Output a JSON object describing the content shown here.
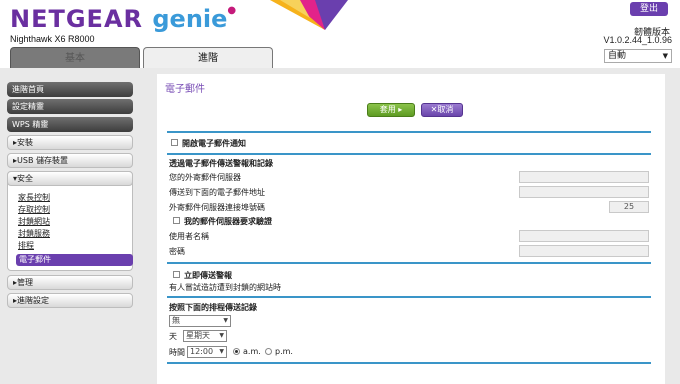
{
  "header": {
    "brand": "NETGEAR",
    "product": "genie",
    "model": "Nighthawk X6 R8000",
    "logout_label": "登出",
    "firmware_label": "韌體版本",
    "firmware_version": "V1.0.2.44_1.0.96",
    "language": "自動"
  },
  "tabs": [
    {
      "label": "基本",
      "selected": false
    },
    {
      "label": "進階",
      "selected": true
    }
  ],
  "sidebar": {
    "home": "進階首頁",
    "setup_wizard": "設定精靈",
    "wps_wizard": "WPS 精靈",
    "setup": "▸安裝",
    "usb_storage": "▸USB 儲存裝置",
    "security": "▾安全",
    "security_items": [
      "家長控制",
      "存取控制",
      "封鎖網站",
      "封鎖服務",
      "排程"
    ],
    "email_active": "電子郵件",
    "admin": "▸管理",
    "advanced_setup": "▸進階設定"
  },
  "main": {
    "title": "電子郵件",
    "apply_label": "套用 ▸",
    "cancel_label": "✕取消",
    "enable_notify": "開啟電子郵件通知",
    "send_logs_heading": "透過電子郵件傳送警報和記錄",
    "smtp_server": "您的外寄郵件伺服器",
    "send_to": "傳送到下面的電子郵件地址",
    "smtp_port_label": "外寄郵件伺服器連接埠號碼",
    "smtp_port_value": "25",
    "auth_required": "我的郵件伺服器要求驗證",
    "username": "使用者名稱",
    "password": "密碼",
    "send_alert_now": "立即傳送警報",
    "alert_desc": "有人嘗試造訪遭到封鎖的網站時",
    "schedule_heading": "按照下面的排程傳送記錄",
    "schedule_value": "無",
    "day_label": "天",
    "day_value": "星期天",
    "time_label": "時間",
    "time_value": "12:00",
    "am_label": "a.m.",
    "pm_label": "p.m."
  },
  "colors": {
    "purple": "#6a3fae",
    "blue_rule": "#3a95c8",
    "apply_green": "#6aab2e"
  }
}
